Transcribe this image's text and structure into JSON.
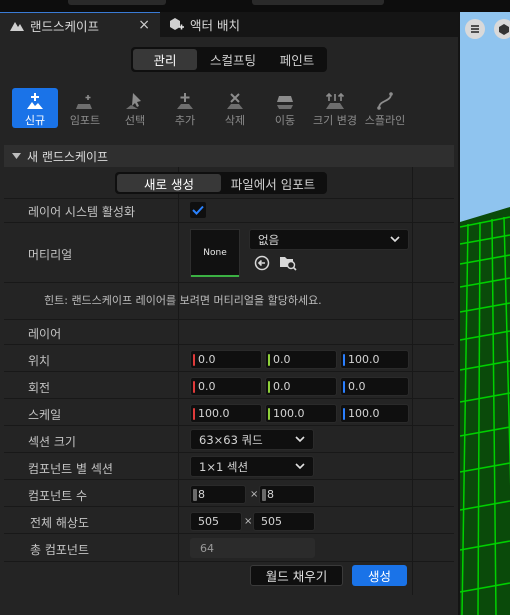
{
  "tabs": [
    {
      "label": "랜드스케이프",
      "active": true
    },
    {
      "label": "액터 배치",
      "active": false
    }
  ],
  "tab_close_glyph": "×",
  "modes": [
    {
      "label": "관리",
      "selected": true
    },
    {
      "label": "스컬프팅",
      "selected": false
    },
    {
      "label": "페인트",
      "selected": false
    }
  ],
  "tools": [
    {
      "label": "신규",
      "icon": "new-landscape-icon",
      "selected": true
    },
    {
      "label": "임포트",
      "icon": "import-icon",
      "selected": false
    },
    {
      "label": "선택",
      "icon": "select-cursor-icon",
      "selected": false
    },
    {
      "label": "추가",
      "icon": "add-component-icon",
      "selected": false
    },
    {
      "label": "삭제",
      "icon": "delete-component-icon",
      "selected": false
    },
    {
      "label": "이동",
      "icon": "move-component-icon",
      "selected": false
    },
    {
      "label": "크기 변경",
      "icon": "resize-icon",
      "selected": false
    },
    {
      "label": "스플라인",
      "icon": "spline-icon",
      "selected": false
    }
  ],
  "section": {
    "title": "새 랜드스케이프"
  },
  "create_tabs": [
    {
      "label": "새로 생성",
      "selected": true
    },
    {
      "label": "파일에서 임포트",
      "selected": false
    }
  ],
  "props": {
    "layer_system_label": "레이어 시스템 활성화",
    "layer_system_enabled": true,
    "material_label": "머티리얼",
    "material_thumb": "None",
    "material_value": "없음",
    "hint": "힌트: 랜드스케이프 레이어를 보려면 머티리얼을 할당하세요.",
    "layers_label": "레이어",
    "location_label": "위치",
    "location": [
      "0.0",
      "0.0",
      "100.0"
    ],
    "rotation_label": "회전",
    "rotation": [
      "0.0",
      "0.0",
      "0.0"
    ],
    "scale_label": "스케일",
    "scale": [
      "100.0",
      "100.0",
      "100.0"
    ],
    "section_size_label": "섹션 크기",
    "section_size": "63×63 쿼드",
    "sections_per_component_label": "컴포넌트 별 섹션",
    "sections_per_component": "1×1 섹션",
    "component_count_label": "컴포넌트 수",
    "component_count": [
      "8",
      "8"
    ],
    "resolution_label": "전체 해상도",
    "resolution": [
      "505",
      "505"
    ],
    "total_components_label": "총 컴포넌트",
    "total_components": "64",
    "times_glyph": "×"
  },
  "actions": {
    "fill_world": "월드 채우기",
    "create": "생성"
  },
  "colors": {
    "accent": "#1a73e8",
    "axis_x": "#e03a3a",
    "axis_y": "#8fd13a",
    "axis_z": "#2a7fff",
    "viewport_grid": "#00d000"
  }
}
